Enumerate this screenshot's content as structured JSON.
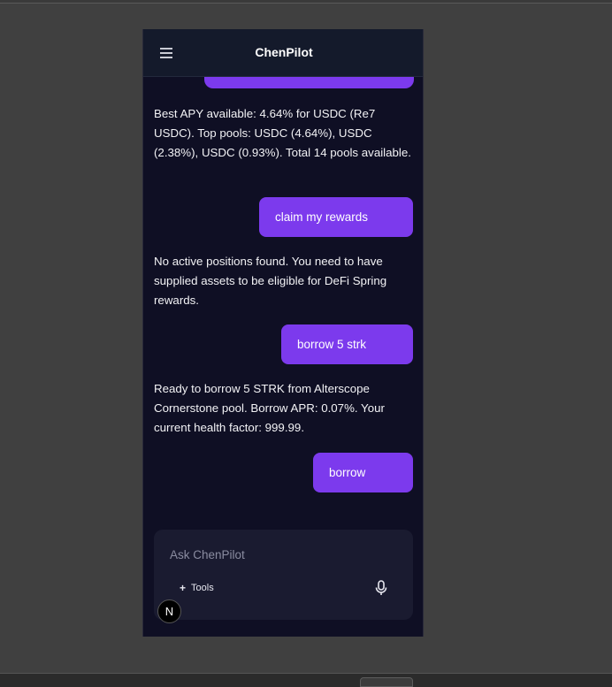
{
  "app": {
    "title": "ChenPilot"
  },
  "messages": [
    {
      "role": "user",
      "text": "claim my rewards"
    },
    {
      "role": "user",
      "text": "borrow 5 strk"
    },
    {
      "role": "user",
      "text": "borrow"
    }
  ],
  "bot_messages": [
    "Best APY available: 4.64% for USDC (Re7 USDC). Top pools: USDC (4.64%), USDC (2.38%), USDC (0.93%). Total 14 pools available.",
    "No active positions found. You need to have supplied assets to be eligible for DeFi Spring rewards.",
    "Ready to borrow 5 STRK from Alterscope Cornerstone pool. Borrow APR: 0.07%. Your current health factor: 999.99."
  ],
  "composer": {
    "placeholder": "Ask ChenPilot",
    "tools_label": "Tools",
    "tools_icon": "plus-icon",
    "mic_icon": "microphone-icon"
  },
  "badge": {
    "letter": "N"
  },
  "colors": {
    "accent": "#7c3aed",
    "panel_bg": "#0f0f24",
    "header_bg": "#141a2b",
    "composer_bg": "#1a1b30"
  }
}
